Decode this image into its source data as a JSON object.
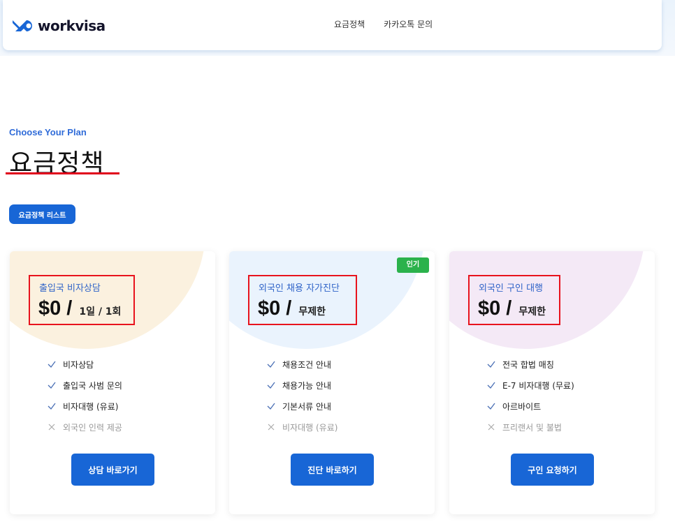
{
  "header": {
    "logo_text": "workvisa",
    "nav": [
      "요금정책",
      "카카오톡 문의"
    ]
  },
  "hero": {
    "eyebrow": "Choose Your Plan",
    "title": "요금정책",
    "list_button": "요금정책 리스트"
  },
  "colors": {
    "brand_blue": "#1866d6",
    "plan_name_blue": "#2f63c8",
    "badge_green": "#2bb24c",
    "highlight_red": "#e8131d",
    "card1_blob": "#fbf1df",
    "card2_blob": "#eaf3fd",
    "card3_blob": "#f4e9f6"
  },
  "plans": [
    {
      "name": "출입국 비자상담",
      "price": "$0",
      "slash": "/",
      "unit": "1일 / 1회",
      "badge": "",
      "features": [
        {
          "label": "비자상담",
          "included": true
        },
        {
          "label": "출입국 사범 문의",
          "included": true
        },
        {
          "label": "비자대행 (유료)",
          "included": true
        },
        {
          "label": "외국인 인력 제공",
          "included": false
        }
      ],
      "cta": "상담 바로가기"
    },
    {
      "name": "외국인 채용 자가진단",
      "price": "$0",
      "slash": "/",
      "unit": "무제한",
      "badge": "인기",
      "features": [
        {
          "label": "채용조건 안내",
          "included": true
        },
        {
          "label": "채용가능 안내",
          "included": true
        },
        {
          "label": "기본서류 안내",
          "included": true
        },
        {
          "label": "비자대행 (유료)",
          "included": false
        }
      ],
      "cta": "진단 바로하기"
    },
    {
      "name": "외국인 구인 대행",
      "price": "$0",
      "slash": "/",
      "unit": "무제한",
      "badge": "",
      "features": [
        {
          "label": "전국 합법 매칭",
          "included": true
        },
        {
          "label": "E-7 비자대행 (무료)",
          "included": true
        },
        {
          "label": "아르바이트",
          "included": true
        },
        {
          "label": "프리랜서 및 불법",
          "included": false
        }
      ],
      "cta": "구인 요청하기"
    }
  ]
}
